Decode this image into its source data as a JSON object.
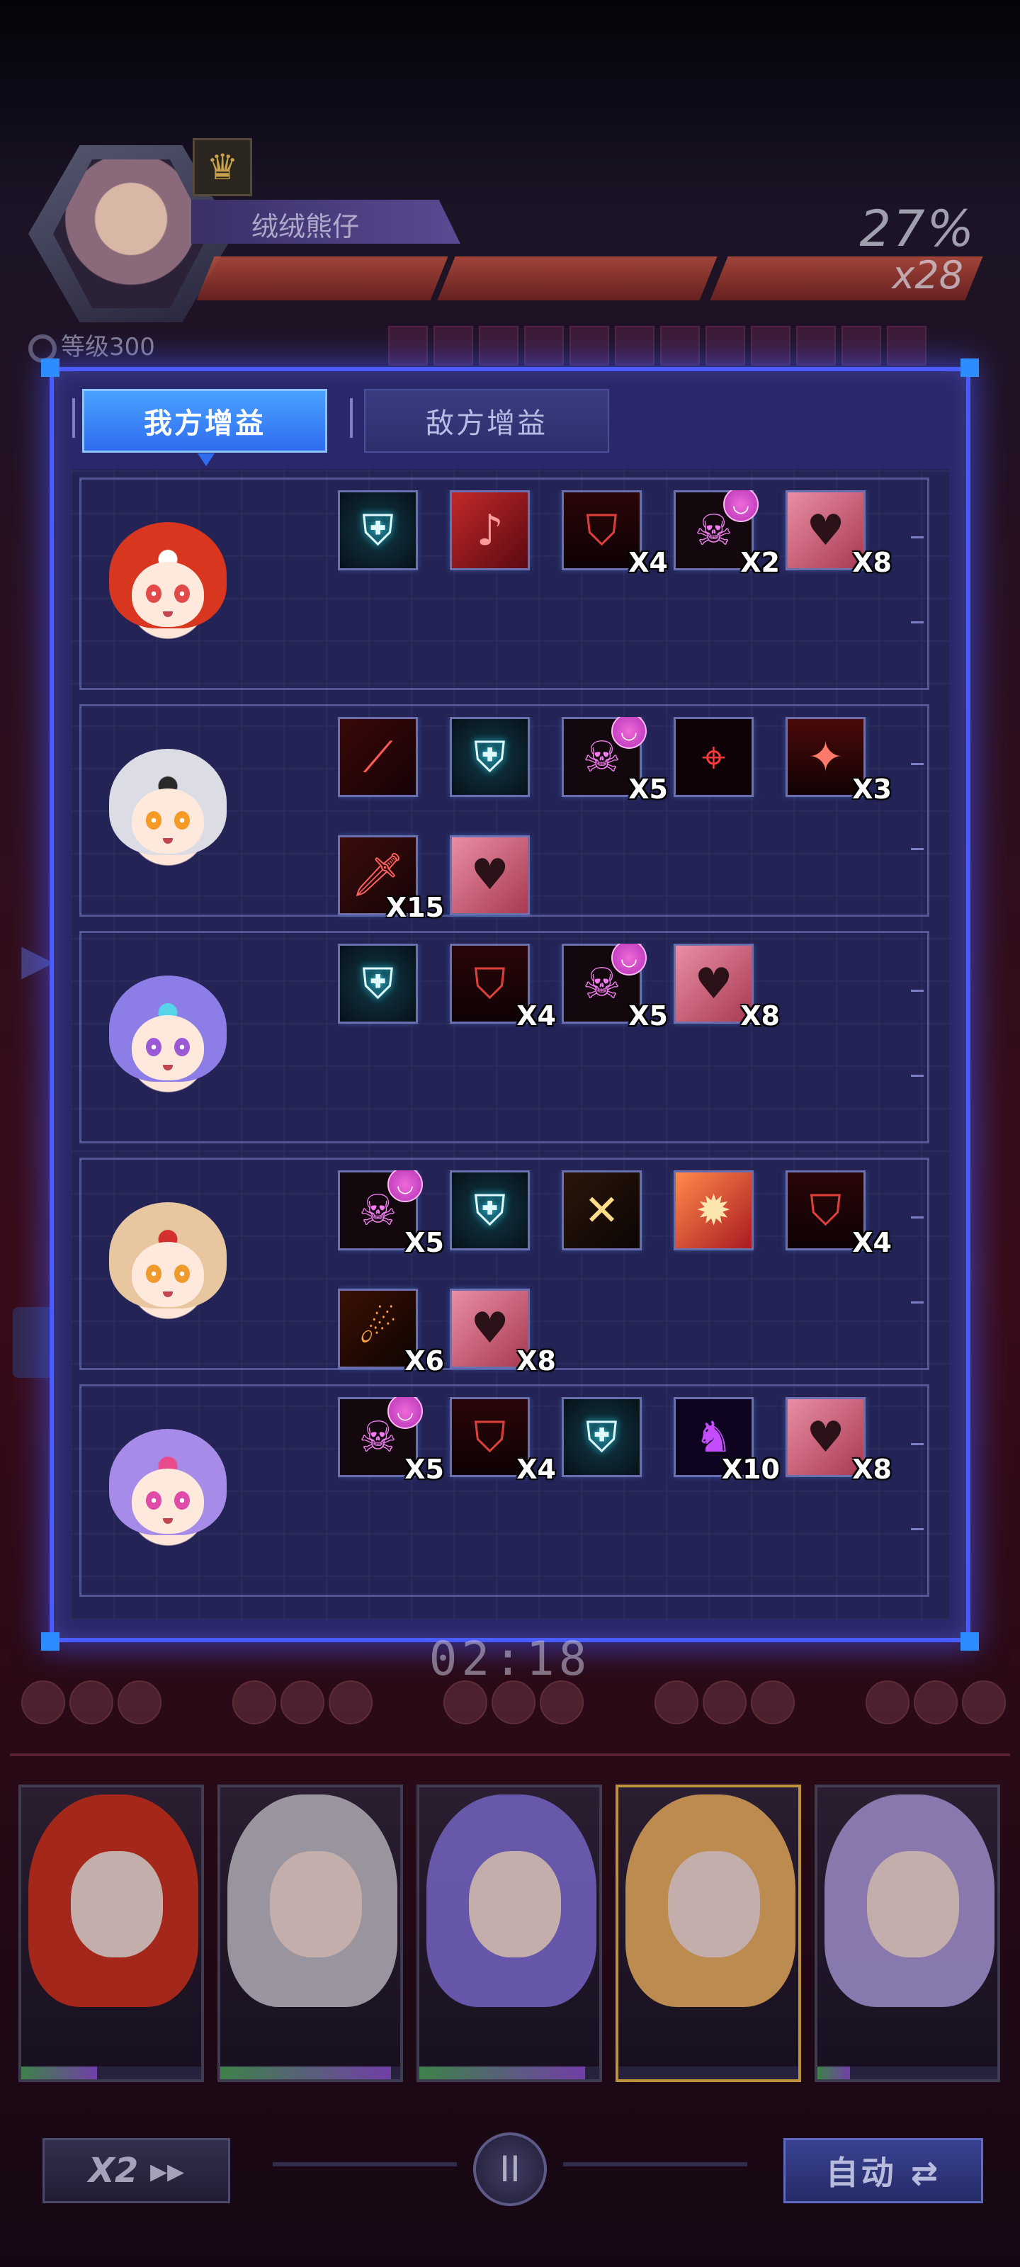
{
  "boss": {
    "name": "绒绒熊仔",
    "level": "等级300",
    "hp_percent": "27%",
    "hp_bars": "x28",
    "badge_icon": "golden-wings-icon"
  },
  "tabs": {
    "ally": "我方增益",
    "enemy": "敌方增益",
    "selected": "ally"
  },
  "characters": [
    {
      "name": "red-hair-girl",
      "hair": "#d8361e",
      "accent": "#ffffff",
      "eye": "#e34a4a",
      "buffs": [
        {
          "icon": "shield-icon",
          "type": "shield",
          "count": ""
        },
        {
          "icon": "dancer-silhouette-icon",
          "type": "dance",
          "count": ""
        },
        {
          "icon": "red-shield-icon",
          "type": "redshield",
          "count": "X4"
        },
        {
          "icon": "pink-skull-icon",
          "type": "pinkskull",
          "count": "X2"
        },
        {
          "icon": "heart-bear-icon",
          "type": "heart",
          "count": "X8"
        }
      ]
    },
    {
      "name": "white-hair-maid",
      "hair": "#dcdce4",
      "accent": "#2a2a2a",
      "eye": "#f59a24",
      "buffs": [
        {
          "icon": "red-blade-icon",
          "type": "blade",
          "count": ""
        },
        {
          "icon": "shield-icon",
          "type": "shield",
          "count": ""
        },
        {
          "icon": "pink-skull-icon",
          "type": "pinkskull",
          "count": "X5"
        },
        {
          "icon": "crosshair-icon",
          "type": "target",
          "count": ""
        },
        {
          "icon": "red-spark-icon",
          "type": "spark",
          "count": "X3"
        },
        {
          "icon": "red-knife-icon",
          "type": "knife",
          "count": "X15"
        },
        {
          "icon": "heart-bear-icon",
          "type": "heart",
          "count": ""
        }
      ]
    },
    {
      "name": "lavender-hair-girl",
      "hair": "#8c7ee6",
      "accent": "#56d4e8",
      "eye": "#9b59d6",
      "buffs": [
        {
          "icon": "shield-icon",
          "type": "shield",
          "count": ""
        },
        {
          "icon": "red-shield-icon",
          "type": "redshield",
          "count": "X4"
        },
        {
          "icon": "pink-skull-icon",
          "type": "pinkskull",
          "count": "X5"
        },
        {
          "icon": "heart-bear-icon",
          "type": "heart",
          "count": "X8"
        }
      ]
    },
    {
      "name": "blonde-hair-girl",
      "hair": "#e8c7a0",
      "accent": "#d42f2f",
      "eye": "#f09a2c",
      "buffs": [
        {
          "icon": "pink-skull-icon",
          "type": "pinkskull",
          "count": "X5"
        },
        {
          "icon": "shield-icon",
          "type": "shield",
          "count": ""
        },
        {
          "icon": "golden-slash-icon",
          "type": "slash",
          "count": ""
        },
        {
          "icon": "fire-burst-icon",
          "type": "fire",
          "count": ""
        },
        {
          "icon": "red-shield-icon",
          "type": "redshield",
          "count": "X4"
        },
        {
          "icon": "flame-sword-icon",
          "type": "flame",
          "count": "X6"
        },
        {
          "icon": "heart-bear-icon",
          "type": "heart",
          "count": "X8"
        }
      ]
    },
    {
      "name": "purple-hair-girl",
      "hair": "#a68ce8",
      "accent": "#e94a8c",
      "eye": "#e04aa8",
      "buffs": [
        {
          "icon": "pink-skull-icon",
          "type": "pinkskull",
          "count": "X5"
        },
        {
          "icon": "red-shield-icon",
          "type": "redshield",
          "count": "X4"
        },
        {
          "icon": "shield-icon",
          "type": "shield",
          "count": ""
        },
        {
          "icon": "purple-dancer-icon",
          "type": "dancer",
          "count": "X10"
        },
        {
          "icon": "heart-bear-icon",
          "type": "heart",
          "count": "X8"
        }
      ]
    }
  ],
  "timer": "02:18",
  "team_cards": [
    {
      "hair": "#c8301c",
      "hp_fill": 0.42
    },
    {
      "hair": "#bcbcc6",
      "hp_fill": 0.95
    },
    {
      "hair": "#7a6ed4",
      "hp_fill": 0.92
    },
    {
      "hair": "#e8b060",
      "hp_fill": 0.0
    },
    {
      "hair": "#a598d8",
      "hp_fill": 0.18
    }
  ],
  "controls": {
    "speed_label": "X2 ▸▸",
    "pause_label": "II",
    "auto_label": "自动 ⇄"
  },
  "colors": {
    "panel_border": "#4a5bff",
    "tab_active": "#3f8cfa",
    "corner_marker": "#2d8cff"
  }
}
